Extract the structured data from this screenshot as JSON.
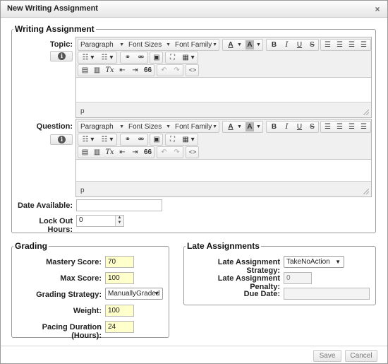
{
  "dialog": {
    "title": "New Writing Assignment",
    "close_icon": "×"
  },
  "writing": {
    "legend": "Writing Assignment",
    "topic_label": "Topic:",
    "question_label": "Question:",
    "info_icon": "i",
    "date_available_label": "Date Available:",
    "date_available_value": "",
    "lock_out_label": "Lock Out Hours:",
    "lock_out_value": "0"
  },
  "editor": {
    "paragraph": "Paragraph",
    "font_sizes": "Font Sizes",
    "font_family": "Font Family",
    "text_color": "A",
    "bg_color": "A",
    "bold": "B",
    "italic": "I",
    "underline": "U",
    "strike": "S",
    "quote": "66",
    "source": "<>",
    "clear_format": "Tx",
    "status_path": "p"
  },
  "grading": {
    "legend": "Grading",
    "mastery_label": "Mastery Score:",
    "mastery_value": "70",
    "max_label": "Max Score:",
    "max_value": "100",
    "strategy_label": "Grading Strategy:",
    "strategy_value": "ManuallyGraded",
    "weight_label": "Weight:",
    "weight_value": "100",
    "pacing_label": "Pacing Duration (Hours):",
    "pacing_value": "24"
  },
  "late": {
    "legend": "Late Assignments",
    "strategy_label": "Late Assignment Strategy:",
    "strategy_value": "TakeNoAction",
    "penalty_label": "Late Assignment Penalty:",
    "penalty_value": "0",
    "due_label": "Due Date:",
    "due_value": ""
  },
  "footer": {
    "save": "Save",
    "cancel": "Cancel"
  },
  "colors": {
    "required_field": "#ffffcc",
    "border": "#9a9a9a"
  }
}
